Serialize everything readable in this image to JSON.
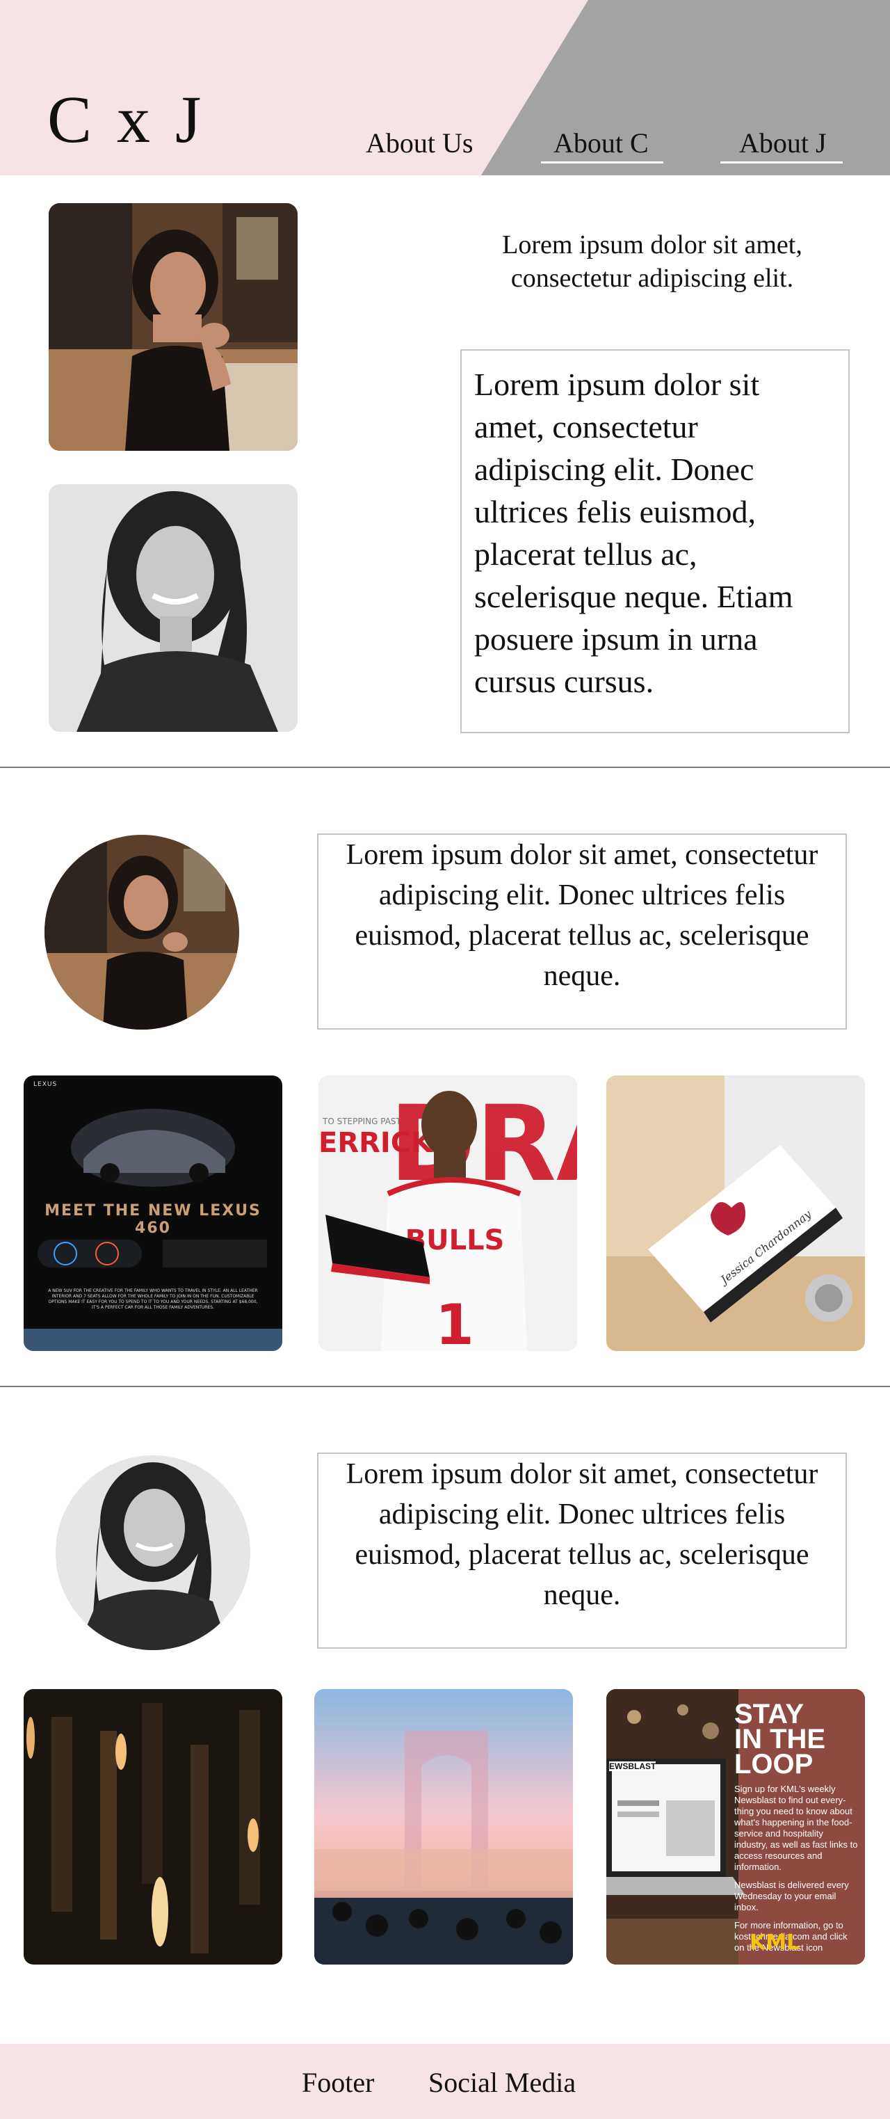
{
  "header": {
    "logo": "C x J",
    "nav": [
      "About Us",
      "About C",
      "About J"
    ]
  },
  "intro": {
    "tagline": "Lorem ipsum dolor sit amet, consectetur adipiscing elit.",
    "body": "Lorem ipsum dolor sit amet, consectetur adipiscing elit. Donec ultrices felis euismod, placerat tellus ac, scelerisque neque. Etiam posuere ipsum in urna cursus cursus."
  },
  "about_c": {
    "bio": "Lorem ipsum dolor sit amet, consectetur adipiscing elit. Donec ultrices felis euismod, placerat tellus ac, scelerisque neque.",
    "works": {
      "lexus": {
        "brand": "LEXUS",
        "headline": "MEET THE NEW LEXUS 460",
        "copy": "A NEW SUV FOR THE CREATIVE FOR THE FAMILY WHO WANTS TO TRAVEL IN STYLE. AN ALL LEATHER INTERIOR AND 7 SEATS ALLOW FOR THE WHOLE FAMILY TO JOIN IN ON THE FUN. CUSTOMIZABLE OPTIONS MAKE IT EASY FOR YOU TO SPEND TO IT TO YOU AND YOUR NEEDS. STARTING AT $68,000, IT'S A PERFECT CAR FOR ALL THOSE FAMILY ADVENTURES."
      },
      "drose": {
        "kicker": "TO STEPPING PAST",
        "name": "ERRICK",
        "big": "DRA",
        "jersey": "BULLS",
        "number": "1"
      },
      "card": {
        "signature": "Jessica Chardonnay"
      }
    }
  },
  "about_j": {
    "bio": "Lorem ipsum dolor sit amet, consectetur adipiscing elit. Donec ultrices felis euismod, placerat tellus ac, scelerisque neque.",
    "works": {
      "kml": {
        "headline_lines": [
          "STAY",
          "IN THE",
          "LOOP"
        ],
        "para1": "Sign up for KML's weekly Newsblast to find out every-thing you need to know about what's happening in the food-service and hospitality industry, as well as fast links to access resources and information.",
        "para2": "Newsblast is delivered every Wednesday to your email inbox.",
        "para3": "For more information, go to kostuchmedia.com and click on the Newsblast icon",
        "logo": "KML",
        "screen_label": "EWSBLAST"
      }
    }
  },
  "footer": {
    "items": [
      "Footer",
      "Social Media"
    ]
  },
  "colors": {
    "header_pink": "#f6e3e5",
    "header_gray": "#a3a3a3",
    "kml_brown": "#8e4a40",
    "bulls_red": "#cf1f2e"
  }
}
